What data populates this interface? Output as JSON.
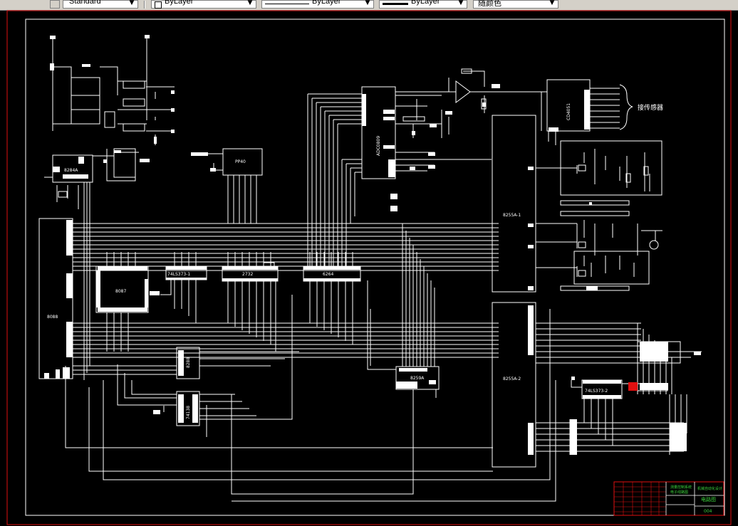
{
  "toolbar": {
    "textstyle": "Standard",
    "layer": "ByLayer",
    "linetype": "ByLayer",
    "lineweight": "ByLayer",
    "color": "随颜色"
  },
  "drawing": {
    "chips": {
      "c8284": "8284A",
      "c8088": "8088",
      "c8087": "8087",
      "c74ls373": "74LS373-1",
      "c2732": "2732",
      "c6264": "6264",
      "cpp40": "PP40",
      "cadc": "ADC0809",
      "ccd4051": "CD4051",
      "c8255a1": "8255A-1",
      "c8255a2": "8255A-2",
      "c8259a": "8259A",
      "c8288": "8288",
      "c74138": "74138",
      "c74ls373b": "74LS373-2"
    },
    "sensor_label": "接传感器",
    "title_block": {
      "name_left": "测量控制系统",
      "name_left2": "电子线路图",
      "project": "机械自动化设计",
      "drawing_name": "电路图",
      "number": "004"
    }
  }
}
